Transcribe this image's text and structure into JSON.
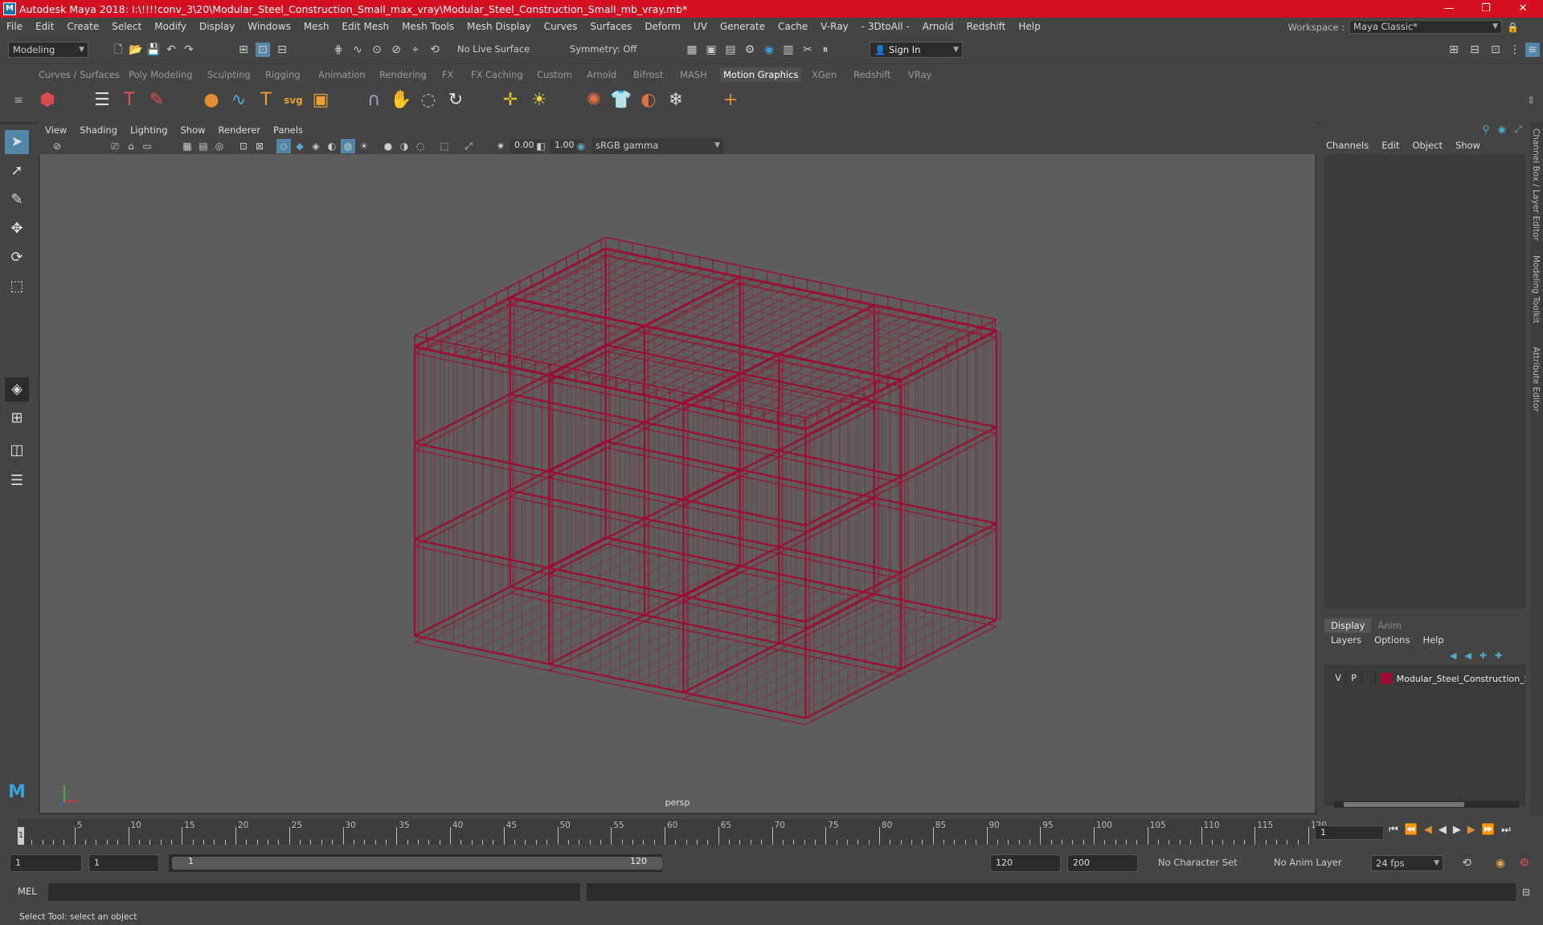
{
  "titlebar": {
    "title": "Autodesk Maya 2018: I:\\!!!!conv_3\\20\\Modular_Steel_Construction_Small_max_vray\\Modular_Steel_Construction_Small_mb_vray.mb*",
    "minimize": "—",
    "maximize": "❐",
    "close": "✕"
  },
  "menubar": {
    "items": [
      "File",
      "Edit",
      "Create",
      "Select",
      "Modify",
      "Display",
      "Windows",
      "Mesh",
      "Edit Mesh",
      "Mesh Tools",
      "Mesh Display",
      "Curves",
      "Surfaces",
      "Deform",
      "UV",
      "Generate",
      "Cache",
      "V-Ray",
      "- 3DtoAll -",
      "Arnold",
      "Redshift",
      "Help"
    ],
    "workspace_label": "Workspace :",
    "workspace_value": "Maya Classic*"
  },
  "statusline": {
    "mode": "Modeling",
    "live_surface": "No Live Surface",
    "symmetry": "Symmetry: Off",
    "sign_in": "Sign In"
  },
  "shelf": {
    "tabs": [
      "Curves / Surfaces",
      "Poly Modeling",
      "Sculpting",
      "Rigging",
      "Animation",
      "Rendering",
      "FX",
      "FX Caching",
      "Custom",
      "Arnold",
      "Bifrost",
      "MASH",
      "Motion Graphics",
      "XGen",
      "Redshift",
      "VRay"
    ],
    "active_tab": "Motion Graphics",
    "svg_label": "svg",
    "type_label": "T"
  },
  "viewport": {
    "menu": [
      "View",
      "Shading",
      "Lighting",
      "Show",
      "Renderer",
      "Panels"
    ],
    "exposure": "0.00",
    "gamma": "1.00",
    "color_space": "sRGB gamma",
    "camera_label": "persp",
    "wire_color": "#9e0b33"
  },
  "channelbox": {
    "tabs": [
      "Channels",
      "Edit",
      "Object",
      "Show"
    ]
  },
  "layers": {
    "tabs": [
      "Display",
      "Anim"
    ],
    "active_tab": "Display",
    "menu": [
      "Layers",
      "Options",
      "Help"
    ],
    "rows": [
      {
        "v": "V",
        "p": "P",
        "name": "Modular_Steel_Construction_S",
        "color": "#9e0b33"
      }
    ]
  },
  "side_tabs": [
    "Channel Box / Layer Editor",
    "Modeling Toolkit",
    "Attribute Editor"
  ],
  "timeline": {
    "ticks": [
      "5",
      "10",
      "15",
      "20",
      "25",
      "30",
      "35",
      "40",
      "45",
      "50",
      "55",
      "60",
      "65",
      "70",
      "75",
      "80",
      "85",
      "90",
      "95",
      "100",
      "105",
      "110",
      "115",
      "120"
    ],
    "current_frame": "1",
    "current_field": "1"
  },
  "range": {
    "start": "1",
    "playback_start": "1",
    "slider_start": "1",
    "slider_end": "120",
    "playback_end": "120",
    "end": "200",
    "character_set": "No Character Set",
    "anim_layer": "No Anim Layer",
    "fps": "24 fps"
  },
  "cmdline": {
    "label": "MEL"
  },
  "helpline": {
    "text": "Select Tool: select an object"
  }
}
